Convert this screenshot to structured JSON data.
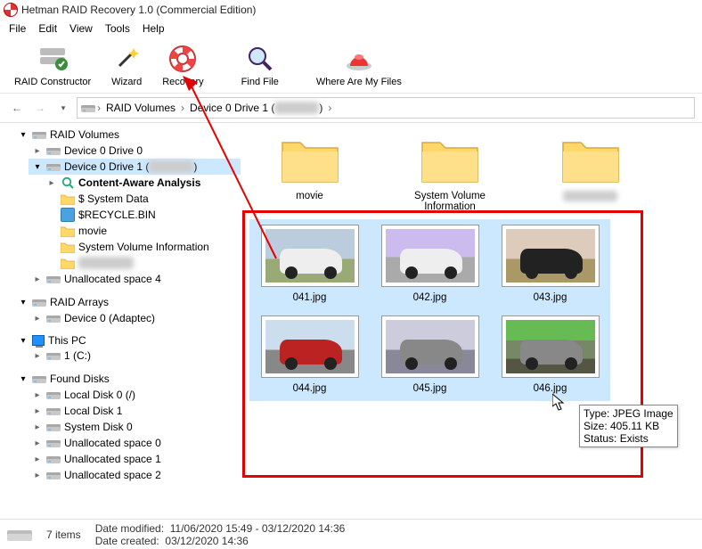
{
  "window": {
    "title": "Hetman RAID Recovery 1.0 (Commercial Edition)"
  },
  "menu": [
    "File",
    "Edit",
    "View",
    "Tools",
    "Help"
  ],
  "toolbar": {
    "items": [
      {
        "label": "RAID Constructor",
        "icon": "raid"
      },
      {
        "label": "Wizard",
        "icon": "wand"
      },
      {
        "label": "Recovery",
        "icon": "lifebuoy"
      },
      {
        "label": "Find File",
        "icon": "magnifier"
      },
      {
        "label": "Where Are My Files",
        "icon": "buzzer"
      }
    ]
  },
  "breadcrumb": {
    "root_icon": "disk",
    "crumbs": [
      "RAID Volumes",
      "Device 0 Drive 1 (",
      "",
      "",
      "",
      "",
      ")"
    ],
    "display": [
      "RAID Volumes",
      "Device 0 Drive 1 ("
    ]
  },
  "tree": {
    "raid_volumes": "RAID Volumes",
    "d0d0": "Device 0 Drive 0",
    "d0d1": "Device 0 Drive 1 (",
    "content_aware": "Content-Aware Analysis",
    "system_data": "$ System Data",
    "recycle": "$RECYCLE.BIN",
    "movie": "movie",
    "svi": "System Volume Information",
    "blur": " ",
    "unalloc4": "Unallocated space 4",
    "raid_arrays": "RAID Arrays",
    "device_adaptec": "Device 0 (Adaptec)",
    "this_pc": "This PC",
    "drive_c": "1 (C:)",
    "found_disks": "Found Disks",
    "ld0": "Local Disk 0 (/)",
    "ld1": "Local Disk 1",
    "sd0": "System Disk 0",
    "u0": "Unallocated space 0",
    "u1": "Unallocated space 1",
    "u2": "Unallocated space 2"
  },
  "folders": [
    {
      "name": "movie"
    },
    {
      "name": "System Volume Information"
    },
    {
      "name": ""
    }
  ],
  "images": [
    {
      "name": "041.jpg"
    },
    {
      "name": "042.jpg"
    },
    {
      "name": "043.jpg"
    },
    {
      "name": "044.jpg"
    },
    {
      "name": "045.jpg"
    },
    {
      "name": "046.jpg"
    }
  ],
  "tooltip": {
    "l1": "Type: JPEG Image",
    "l2": "Size: 405.11 KB",
    "l3": "Status: Exists"
  },
  "status": {
    "count": "7 items",
    "modified_label": "Date modified:",
    "modified_value": "11/06/2020 15:49 - 03/12/2020 14:36",
    "created_label": "Date created:",
    "created_value": "03/12/2020 14:36"
  },
  "colors": {
    "selection": "#cce8ff",
    "highlight": "#e30202"
  }
}
